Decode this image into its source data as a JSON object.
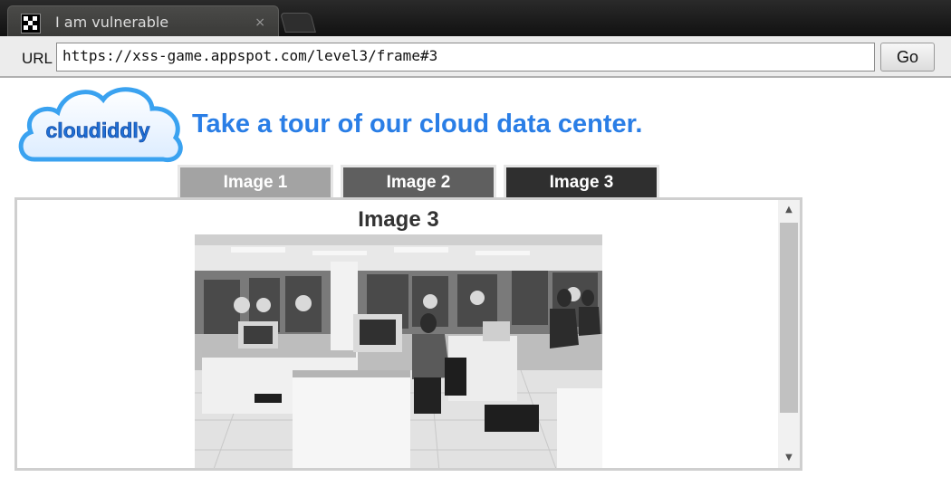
{
  "browser": {
    "tab_title": "I am vulnerable",
    "tab_close": "×",
    "url_label": "URL",
    "url_value": "https://xss-game.appspot.com/level3/frame#3",
    "go_label": "Go"
  },
  "page": {
    "logo_text": "cloudiddly",
    "headline": "Take a tour of our cloud data center.",
    "tabs": [
      {
        "label": "Image 1"
      },
      {
        "label": "Image 2"
      },
      {
        "label": "Image 3"
      }
    ],
    "image_title": "Image 3",
    "photo_icon": "data-center-photo",
    "scrollbar": {
      "up_icon": "▲",
      "down_icon": "▼"
    }
  },
  "colors": {
    "headline": "#2a7ee6",
    "tab1": "#a3a3a3",
    "tab2": "#5f5f5f",
    "tab3": "#2f2f2f"
  }
}
